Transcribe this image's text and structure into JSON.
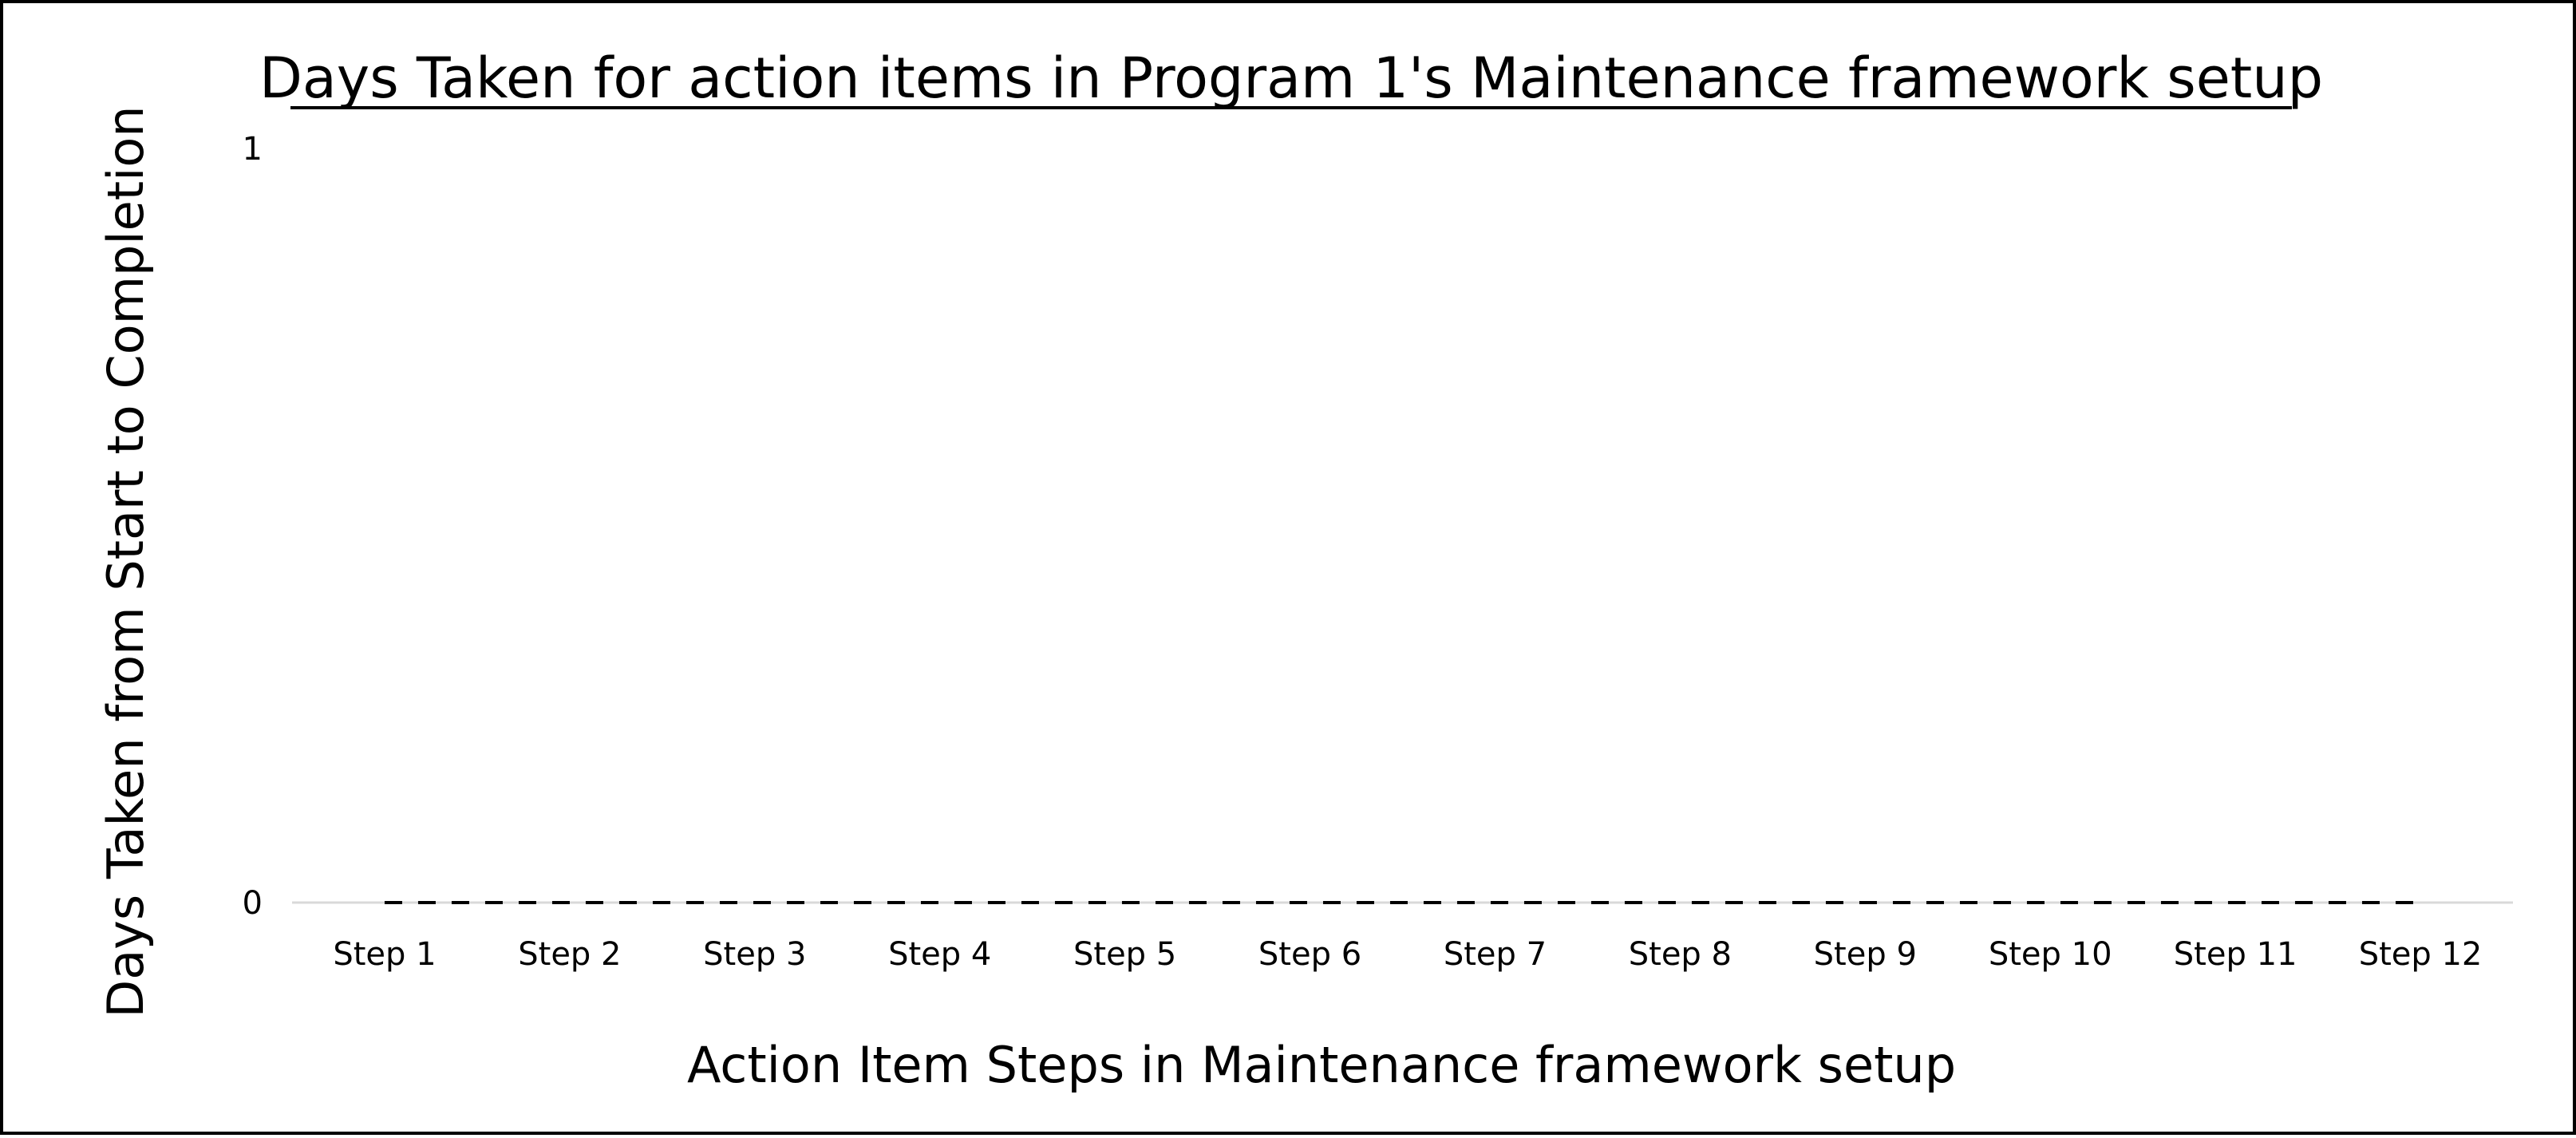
{
  "chart_data": {
    "type": "line",
    "title": "Days Taken for action items in Program 1's Maintenance framework setup",
    "xlabel": "Action Item Steps in Maintenance framework setup",
    "ylabel": "Days Taken from Start to Completion",
    "categories": [
      "Step 1",
      "Step 2",
      "Step 3",
      "Step 4",
      "Step 5",
      "Step 6",
      "Step 7",
      "Step 8",
      "Step 9",
      "Step 10",
      "Step 11",
      "Step 12"
    ],
    "series": [
      {
        "values": [
          0,
          0,
          0,
          0,
          0,
          0,
          0,
          0,
          0,
          0,
          0,
          0
        ],
        "style": "dashed",
        "color": "#000000"
      }
    ],
    "yticks": [
      "0",
      "1"
    ],
    "ylim": [
      0,
      1
    ],
    "grid": false,
    "legend": "none"
  }
}
